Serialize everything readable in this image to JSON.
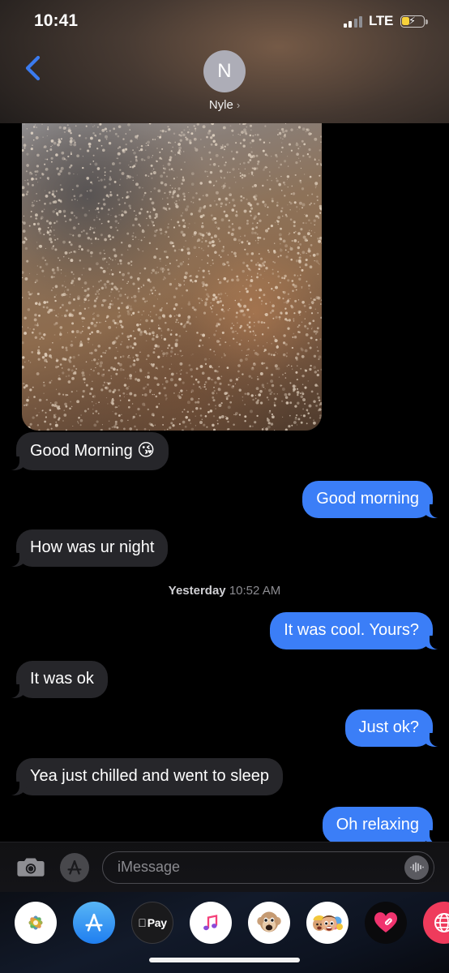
{
  "status_bar": {
    "time": "10:41",
    "network": "LTE",
    "signal_bars_filled": 2,
    "signal_bars_total": 4,
    "battery_state": "charging-low-power",
    "battery_color": "#f7d13a"
  },
  "header": {
    "back_label": "‹",
    "avatar_initial": "N",
    "contact_name": "Nyle",
    "disclosure": "›",
    "accent_color": "#3b7bef"
  },
  "thread": {
    "attachment": {
      "type": "photo",
      "alt": "blurred warm-toned photo with light speckles"
    },
    "timestamp": {
      "day": "Yesterday",
      "time": "10:52 AM"
    },
    "messages": [
      {
        "id": 1,
        "side": "in",
        "text": "Good Morning ",
        "emoji": "😘"
      },
      {
        "id": 2,
        "side": "out",
        "text": "Good morning"
      },
      {
        "id": 3,
        "side": "in",
        "text": "How was ur night"
      },
      {
        "id": 4,
        "side": "out",
        "text": "It was cool. Yours?"
      },
      {
        "id": 5,
        "side": "in",
        "text": "It was ok"
      },
      {
        "id": 6,
        "side": "out",
        "text": "Just ok?"
      },
      {
        "id": 7,
        "side": "in",
        "text": "Yea just chilled and went to sleep"
      },
      {
        "id": 8,
        "side": "out",
        "text": "Oh relaxing"
      }
    ],
    "bubble_in_color": "#26262a",
    "bubble_out_color": "#3b7ef7"
  },
  "input_bar": {
    "camera_icon": "camera-icon",
    "apps_icon": "app-store-icon",
    "placeholder": "iMessage",
    "value": "",
    "audio_icon": "audio-waveform-icon"
  },
  "app_drawer": {
    "apps": [
      {
        "name": "photos",
        "label": "Photos"
      },
      {
        "name": "app-store",
        "label": "App Store"
      },
      {
        "name": "apple-pay",
        "label": "Pay"
      },
      {
        "name": "music",
        "label": "Music"
      },
      {
        "name": "animoji",
        "label": "Animoji"
      },
      {
        "name": "memoji",
        "label": "Memoji"
      },
      {
        "name": "digital-touch",
        "label": "Digital Touch"
      },
      {
        "name": "globe-app",
        "label": "Globe"
      }
    ]
  }
}
